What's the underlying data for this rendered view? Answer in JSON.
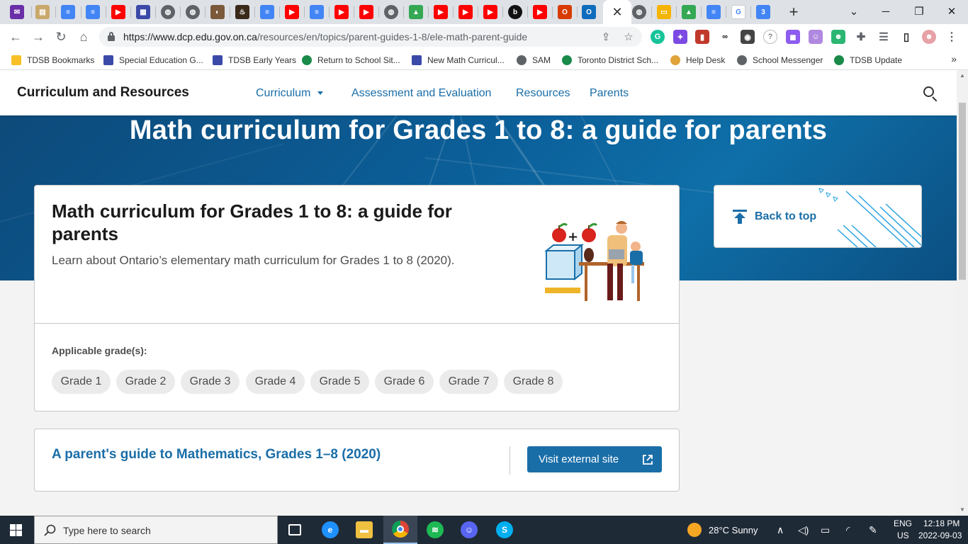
{
  "browser": {
    "url_host": "https://www.dcp.edu.gov.on.ca",
    "url_path": "/resources/en/topics/parent-guides-1-8/ele-math-parent-guide",
    "new_tab_symbol": "+",
    "close_tab_symbol": "✕",
    "bookmarks": [
      {
        "label": "TDSB Bookmarks",
        "color": "#f6c026"
      },
      {
        "label": "Special Education G...",
        "color": "#3b4aa8"
      },
      {
        "label": "TDSB Early Years",
        "color": "#3b4aa8"
      },
      {
        "label": "Return to School Sit...",
        "color": "#1a8a4a"
      },
      {
        "label": "New Math Curricul...",
        "color": "#3b4aa8"
      },
      {
        "label": "SAM",
        "color": "#5f6368"
      },
      {
        "label": "Toronto District Sch...",
        "color": "#1a8a4a"
      },
      {
        "label": "Help Desk",
        "color": "#e0a33a"
      },
      {
        "label": "School Messenger",
        "color": "#5f6368"
      },
      {
        "label": "TDSB Update",
        "color": "#1a8a4a"
      }
    ],
    "bookmarks_more": "»"
  },
  "site": {
    "title": "Curriculum and Resources",
    "nav": {
      "curriculum": "Curriculum",
      "assessment": "Assessment and Evaluation",
      "resources": "Resources",
      "parents": "Parents"
    }
  },
  "hero": {
    "title": "Math curriculum for Grades 1 to 8: a guide for parents"
  },
  "main_card": {
    "title": "Math curriculum for Grades 1 to 8: a guide for parents",
    "description": "Learn about Ontario’s elementary math curriculum for Grades 1 to 8 (2020).",
    "grades_label": "Applicable grade(s):",
    "grades": [
      "Grade 1",
      "Grade 2",
      "Grade 3",
      "Grade 4",
      "Grade 5",
      "Grade 6",
      "Grade 7",
      "Grade 8"
    ]
  },
  "back_to_top": {
    "label": "Back to top"
  },
  "link_card": {
    "title": "A parent's guide to Mathematics, Grades 1–8 (2020)",
    "button": "Visit external site"
  },
  "taskbar": {
    "search_placeholder": "Type here to search",
    "weather": "28°C  Sunny",
    "lang_top": "ENG",
    "lang_bottom": "US",
    "time": "12:18 PM",
    "date": "2022-09-03"
  },
  "colors": {
    "brand_blue": "#1a6ea8",
    "hero_dark": "#0d4a7a",
    "taskbar": "#1f2a37"
  }
}
